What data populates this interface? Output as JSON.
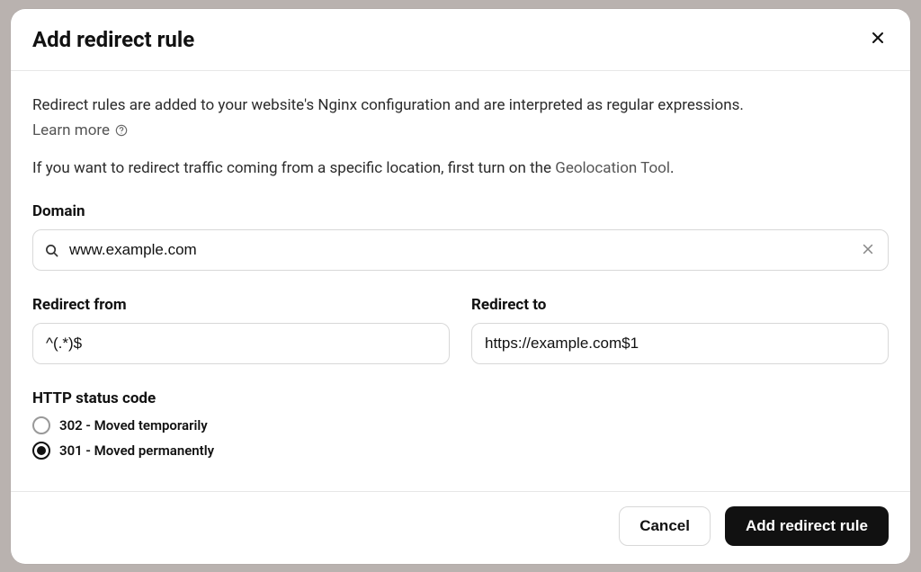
{
  "header": {
    "title": "Add redirect rule"
  },
  "body": {
    "intro": "Redirect rules are added to your website's Nginx configuration and are interpreted as regular expressions.",
    "learn_more": "Learn more",
    "geo_prefix": "If you want to redirect traffic coming from a specific location, first turn on the ",
    "geo_link": "Geolocation Tool",
    "geo_suffix": "."
  },
  "domain": {
    "label": "Domain",
    "value": "www.example.com"
  },
  "redirect_from": {
    "label": "Redirect from",
    "value": "^(.*)$"
  },
  "redirect_to": {
    "label": "Redirect to",
    "value": "https://example.com$1"
  },
  "status": {
    "label": "HTTP status code",
    "options": [
      {
        "label": "302 - Moved temporarily",
        "selected": false
      },
      {
        "label": "301 - Moved permanently",
        "selected": true
      }
    ]
  },
  "footer": {
    "cancel": "Cancel",
    "submit": "Add redirect rule"
  }
}
